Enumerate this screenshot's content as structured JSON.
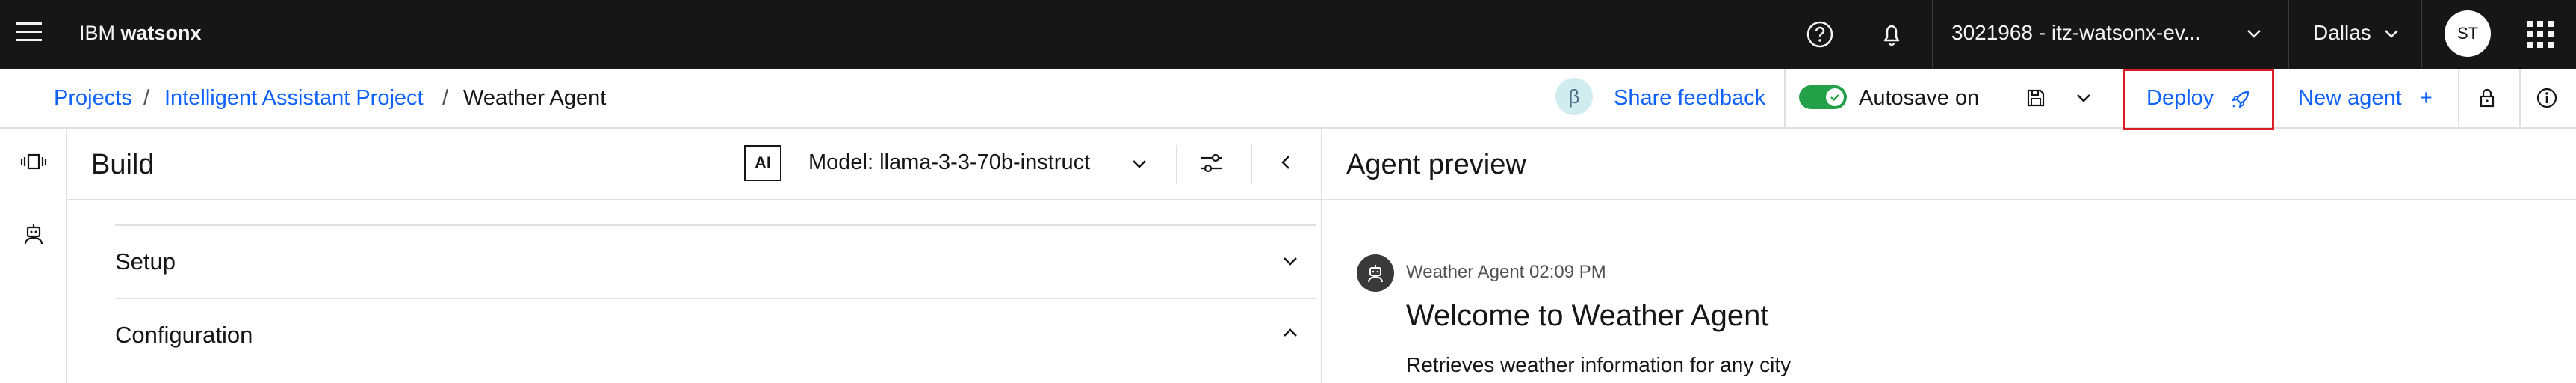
{
  "topbar": {
    "brand_prefix": "IBM",
    "brand_product": "watsonx",
    "account": "3021968 - itz-watsonx-ev...",
    "region": "Dallas",
    "user_initials": "ST",
    "icons": [
      "menu-icon",
      "help-icon",
      "notification-icon",
      "chevron-down-icon",
      "app-switcher-icon"
    ]
  },
  "breadcrumb": {
    "items": [
      "Projects",
      "Intelligent Assistant Project",
      "Weather Agent"
    ],
    "separator": "/"
  },
  "toolbar": {
    "beta_label": "β",
    "share_feedback": "Share feedback",
    "autosave_label": "Autosave on",
    "autosave_enabled": true,
    "deploy_label": "Deploy",
    "new_agent_label": "New agent",
    "new_agent_plus": "+"
  },
  "build": {
    "title": "Build",
    "ai_badge": "AI",
    "model_label": "Model: llama-3-3-70b-instruct",
    "sections": [
      {
        "title": "Setup",
        "expanded": false
      },
      {
        "title": "Configuration",
        "expanded": true
      }
    ]
  },
  "preview": {
    "title": "Agent preview",
    "message": {
      "meta": "Weather Agent 02:09 PM",
      "heading": "Welcome to Weather Agent",
      "body": "Retrieves weather information for any city"
    }
  },
  "colors": {
    "header_bg": "#161616",
    "link": "#0f62fe",
    "toggle_on": "#24a148",
    "deploy_highlight": "#da1e28",
    "border": "#e0e0e0"
  }
}
